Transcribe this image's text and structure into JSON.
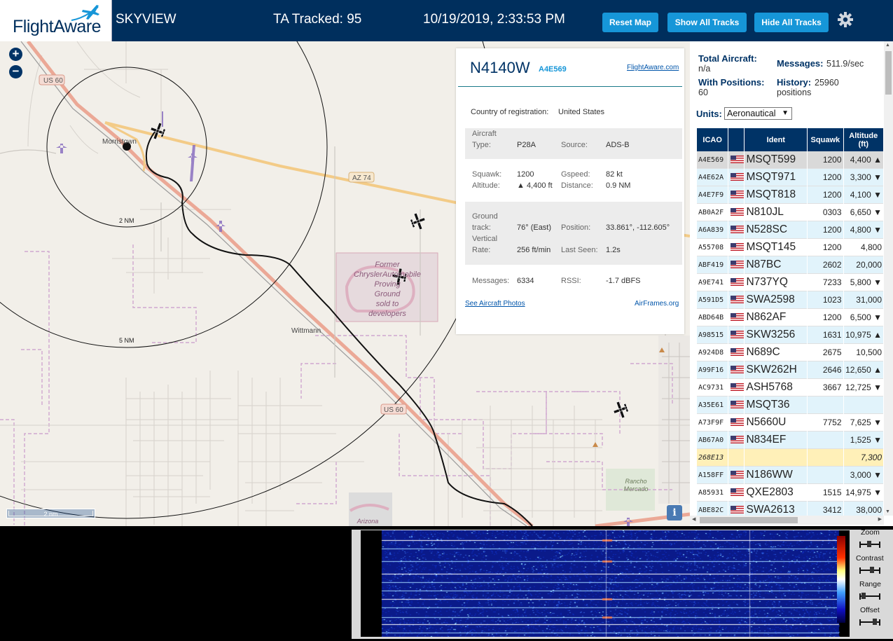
{
  "header": {
    "logo_text": "FlightAware",
    "app_title": "SKYVIEW",
    "tracked": "TA Tracked: 95",
    "clock": "10/19/2019, 2:33:53 PM",
    "buttons": {
      "reset": "Reset Map",
      "show": "Show All Tracks",
      "hide": "Hide All Tracks"
    }
  },
  "map": {
    "labels": {
      "us60_a": "US 60",
      "us60_b": "US 60",
      "az74": "AZ 74",
      "morristown": "Morristown",
      "wittmann": "Wittmann",
      "ring_2": "2 NM",
      "ring_5": "5 NM",
      "proving1": "Former",
      "proving2": "ChryslerAutomobile",
      "proving3": "Proving",
      "proving4": "Ground",
      "proving5": "sold to",
      "proving6": "developers",
      "rancho1": "Rancho",
      "rancho2": "Mercado",
      "arizona": "Arizona"
    },
    "scale": "2 nm",
    "info": "i"
  },
  "selected": {
    "registration": "N4140W",
    "hex": "A4E569",
    "fa_link": "FlightAware.com",
    "country_label": "Country of registration:",
    "country": "United States",
    "aircraft_type_label1": "Aircraft",
    "aircraft_type_label2": "Type:",
    "aircraft_type": "P28A",
    "source_label": "Source:",
    "source": "ADS-B",
    "squawk_label": "Squawk:",
    "squawk": "1200",
    "gspeed_label": "Gspeed:",
    "gspeed": "82 kt",
    "altitude_label": "Altitude:",
    "altitude": "▲ 4,400 ft",
    "distance_label": "Distance:",
    "distance": "0.9 NM",
    "ground_label1": "Ground",
    "ground_label2": "track:",
    "ground_track": "76° (East)",
    "position_label": "Position:",
    "position": "33.861°, -112.605°",
    "vr_label1": "Vertical",
    "vr_label2": "Rate:",
    "vertical_rate": "256 ft/min",
    "last_seen_label": "Last Seen:",
    "last_seen": "1.2s",
    "messages_label": "Messages:",
    "messages": "6334",
    "rssi_label": "RSSI:",
    "rssi": "-1.7 dBFS",
    "photos_link": "See Aircraft Photos",
    "airframes_link": "AirFrames.org"
  },
  "stats": {
    "total_label": "Total Aircraft:",
    "total": "n/a",
    "messages_label": "Messages:",
    "messages": "511.9/sec",
    "with_pos_label": "With Positions:",
    "with_pos": "60",
    "history_label": "History:",
    "history_1": "25960",
    "history_2": "positions",
    "units_label": "Units:",
    "units": "Aeronautical"
  },
  "table": {
    "headers": [
      "ICAO",
      "",
      "Ident",
      "Squawk",
      "Altitude (ft)"
    ],
    "rows": [
      {
        "icao": "A4E569",
        "ident": "MSQT599",
        "squawk": "1200",
        "alt": "4,400 ▲",
        "flag": true,
        "style": "sel"
      },
      {
        "icao": "A4E62A",
        "ident": "MSQT971",
        "squawk": "1200",
        "alt": "3,300 ▼",
        "flag": true,
        "style": "alt"
      },
      {
        "icao": "A4E7F9",
        "ident": "MSQT818",
        "squawk": "1200",
        "alt": "4,100 ▼",
        "flag": true,
        "style": "alt"
      },
      {
        "icao": "AB0A2F",
        "ident": "N810JL",
        "squawk": "0303",
        "alt": "6,650 ▼",
        "flag": true,
        "style": ""
      },
      {
        "icao": "A6A839",
        "ident": "N528SC",
        "squawk": "1200",
        "alt": "4,800 ▼",
        "flag": true,
        "style": "alt"
      },
      {
        "icao": "A55708",
        "ident": "MSQT145",
        "squawk": "1200",
        "alt": "4,800",
        "flag": true,
        "style": ""
      },
      {
        "icao": "ABF419",
        "ident": "N87BC",
        "squawk": "2602",
        "alt": "20,000",
        "flag": true,
        "style": "alt"
      },
      {
        "icao": "A9E741",
        "ident": "N737YQ",
        "squawk": "7233",
        "alt": "5,800 ▼",
        "flag": true,
        "style": ""
      },
      {
        "icao": "A591D5",
        "ident": "SWA2598",
        "squawk": "1023",
        "alt": "31,000",
        "flag": true,
        "style": "alt"
      },
      {
        "icao": "ABD64B",
        "ident": "N862AF",
        "squawk": "1200",
        "alt": "6,500 ▼",
        "flag": true,
        "style": ""
      },
      {
        "icao": "A98515",
        "ident": "SKW3256",
        "squawk": "1631",
        "alt": "10,975 ▲",
        "flag": true,
        "style": "alt"
      },
      {
        "icao": "A924D8",
        "ident": "N689C",
        "squawk": "2675",
        "alt": "10,500",
        "flag": true,
        "style": ""
      },
      {
        "icao": "A99F16",
        "ident": "SKW262H",
        "squawk": "2646",
        "alt": "12,650 ▲",
        "flag": true,
        "style": "alt"
      },
      {
        "icao": "AC9731",
        "ident": "ASH5768",
        "squawk": "3667",
        "alt": "12,725 ▼",
        "flag": true,
        "style": ""
      },
      {
        "icao": "A35E61",
        "ident": "MSQT36",
        "squawk": "",
        "alt": "",
        "flag": true,
        "style": "alt"
      },
      {
        "icao": "A73F9F",
        "ident": "N5660U",
        "squawk": "7752",
        "alt": "7,625 ▼",
        "flag": true,
        "style": ""
      },
      {
        "icao": "AB67A0",
        "ident": "N834EF",
        "squawk": "",
        "alt": "1,525 ▼",
        "flag": true,
        "style": "alt"
      },
      {
        "icao": "268E13",
        "ident": "",
        "squawk": "",
        "alt": "7,300",
        "flag": false,
        "style": "noflag"
      },
      {
        "icao": "A158FF",
        "ident": "N186WW",
        "squawk": "",
        "alt": "3,000 ▼",
        "flag": true,
        "style": "alt"
      },
      {
        "icao": "A85931",
        "ident": "QXE2803",
        "squawk": "1515",
        "alt": "14,975 ▼",
        "flag": true,
        "style": ""
      },
      {
        "icao": "ABE82C",
        "ident": "SWA2613",
        "squawk": "3412",
        "alt": "38,000",
        "flag": true,
        "style": "alt"
      }
    ]
  },
  "spectrum": {
    "controls": [
      "Zoom",
      "Contrast",
      "Range",
      "Offset"
    ]
  },
  "colors": {
    "header_bg": "#002f5d",
    "button": "#1696d8",
    "accent": "#003366"
  }
}
